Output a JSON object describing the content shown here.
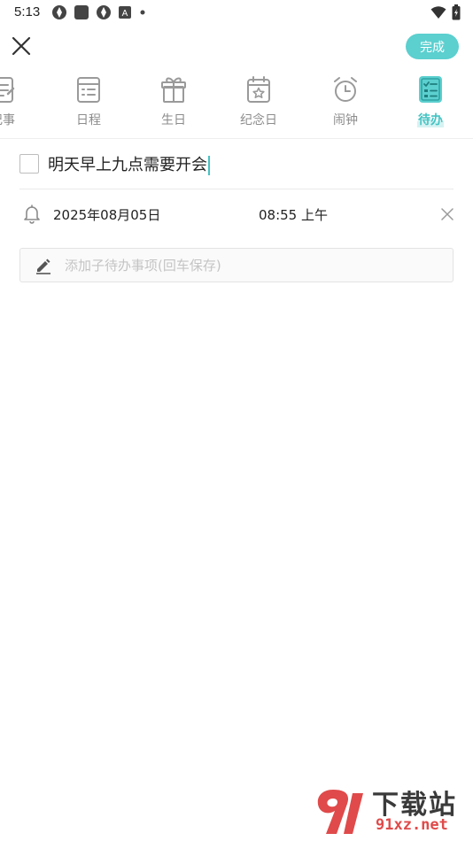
{
  "status_bar": {
    "time": "5:13",
    "left_icons": [
      "app-icon-1",
      "app-icon-2",
      "app-icon-3",
      "a-icon",
      "dot-icon"
    ],
    "right_icons": [
      "wifi-icon",
      "battery-icon"
    ]
  },
  "top_bar": {
    "close_icon": "close-icon",
    "done_label": "完成",
    "done_color": "#5ccfcf"
  },
  "tabs": [
    {
      "label": "记事",
      "icon": "note-icon",
      "active": false
    },
    {
      "label": "日程",
      "icon": "schedule-icon",
      "active": false
    },
    {
      "label": "生日",
      "icon": "gift-icon",
      "active": false
    },
    {
      "label": "纪念日",
      "icon": "anniversary-icon",
      "active": false
    },
    {
      "label": "闹钟",
      "icon": "alarm-icon",
      "active": false
    },
    {
      "label": "待办",
      "icon": "todo-icon",
      "active": true
    }
  ],
  "accent_color": "#45c3c3",
  "todo": {
    "text": "明天早上九点需要开会",
    "checked": false
  },
  "reminder": {
    "date": "2025年08月05日",
    "time": "08:55 上午",
    "icon": "bell-icon",
    "clear_icon": "clear-icon"
  },
  "subtask": {
    "placeholder": "添加子待办事项(回车保存)",
    "icon": "pencil-icon"
  },
  "watermark": {
    "title": "下载站",
    "domain": "91xz.net"
  }
}
